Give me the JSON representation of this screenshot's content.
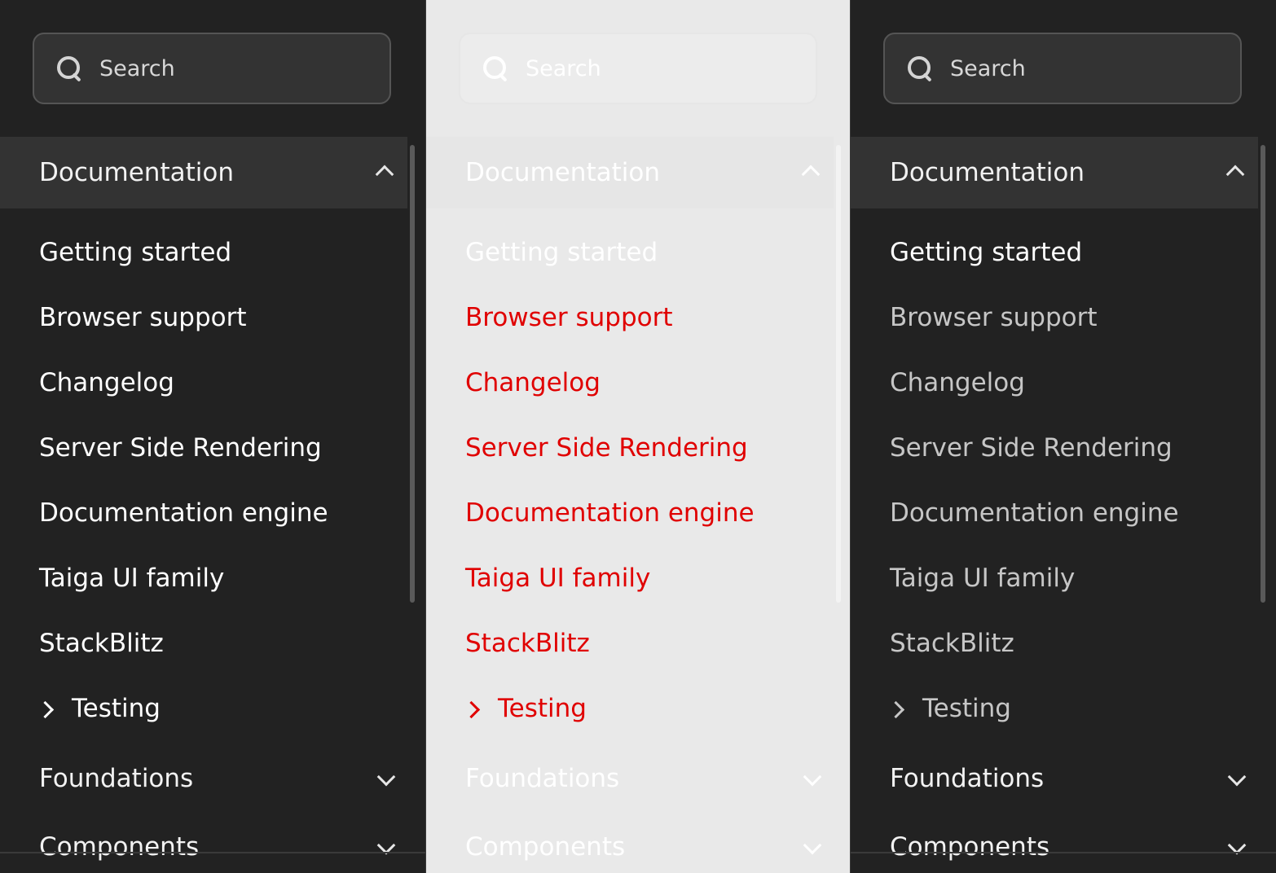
{
  "search": {
    "placeholder": "Search"
  },
  "section": {
    "title": "Documentation"
  },
  "items": [
    "Getting started",
    "Browser support",
    "Changelog",
    "Server Side Rendering",
    "Documentation engine",
    "Taiga UI family",
    "StackBlitz"
  ],
  "testing": {
    "label": "Testing"
  },
  "groups": {
    "foundations": "Foundations",
    "components": "Components"
  },
  "icons": {
    "search": "search-icon",
    "collapse": "chevron-up-icon",
    "expand": "chevron-down-icon",
    "submenu": "chevron-right-icon"
  },
  "colors": {
    "dark_bg": "#222222",
    "light_bg": "#e9e9e9",
    "highlight_red": "#e00000"
  }
}
